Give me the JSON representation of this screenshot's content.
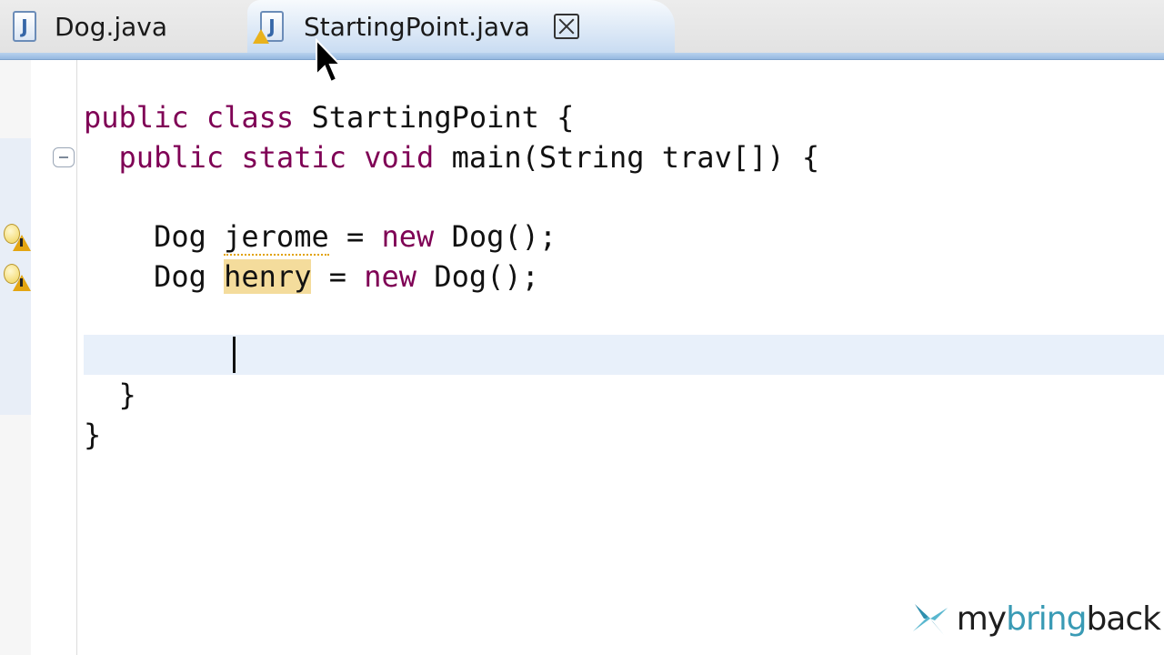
{
  "tabs": [
    {
      "label": "Dog.java",
      "active": false,
      "icon": "java-file-icon"
    },
    {
      "label": "StartingPoint.java",
      "active": true,
      "icon": "java-file-warning-icon",
      "closable": true
    }
  ],
  "editor": {
    "lines": {
      "class_decl": {
        "kw1": "public",
        "kw2": "class",
        "rest": "StartingPoint {"
      },
      "main_decl": {
        "kw1": "public",
        "kw2": "static",
        "kw3": "void",
        "rest": "main(String trav[]) {"
      },
      "jerome": {
        "type": "Dog",
        "var": "jerome",
        "eq": " = ",
        "kw": "new",
        "rest": "Dog();"
      },
      "henry": {
        "type": "Dog",
        "var": "henry",
        "eq": " = ",
        "kw": "new",
        "rest": "Dog();"
      },
      "close_main": "}",
      "close_class": "}"
    },
    "warnings": [
      "line-jerome",
      "line-henry"
    ]
  },
  "watermark": {
    "prefix": "my",
    "accent": "bring",
    "suffix": "back"
  },
  "colors": {
    "keyword": "#7f0055",
    "tab_accent": "#95b8e0",
    "current_line": "#e8f0fa",
    "logo_accent": "#3a9bb5"
  }
}
